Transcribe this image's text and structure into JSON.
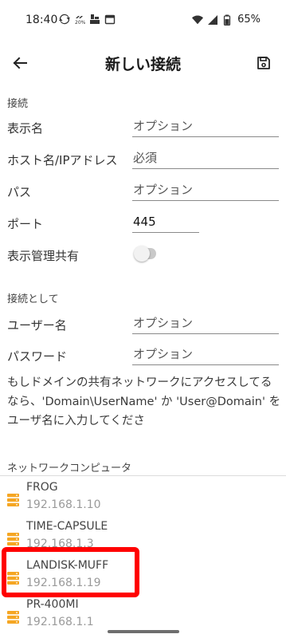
{
  "status_bar": {
    "time": "18:40",
    "battery": "65%",
    "icons": [
      "sync-icon",
      "data-saver-icon",
      "storage-icon",
      "calendar-icon",
      "wifi-icon",
      "signal-icon",
      "battery-icon"
    ]
  },
  "app_bar": {
    "title": "新しい接続"
  },
  "connection": {
    "section_label": "接続",
    "display_name": {
      "label": "表示名",
      "placeholder": "オプション",
      "value": ""
    },
    "host": {
      "label": "ホスト名/IPアドレス",
      "placeholder": "必須",
      "value": ""
    },
    "path": {
      "label": "パス",
      "placeholder": "オプション",
      "value": ""
    },
    "port": {
      "label": "ポート",
      "value": "445"
    },
    "show_admin_shares": {
      "label": "表示管理共有",
      "on": false
    }
  },
  "credentials": {
    "section_label": "接続として",
    "username": {
      "label": "ユーザー名",
      "placeholder": "オプション",
      "value": ""
    },
    "password": {
      "label": "パスワード",
      "placeholder": "オプション",
      "value": ""
    },
    "hint": "もしドメインの共有ネットワークにアクセスしてるなら、'Domain\\UserName' か 'User@Domain' をユーザ名に入力してくださ"
  },
  "network": {
    "section_label": "ネットワークコンピュータ",
    "items": [
      {
        "name": "FROG",
        "ip": "192.168.1.10"
      },
      {
        "name": "TIME-CAPSULE",
        "ip": "192.168.1.3"
      },
      {
        "name": "LANDISK-MUFF",
        "ip": "192.168.1.19"
      },
      {
        "name": "PR-400MI",
        "ip": "192.168.1.1"
      }
    ]
  },
  "colors": {
    "accent": "#f5a623",
    "highlight": "#ff0000",
    "toggle_off": "#c9c9c9"
  }
}
